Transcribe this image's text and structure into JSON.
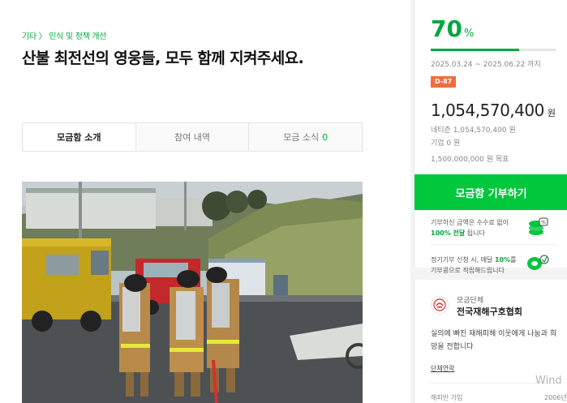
{
  "breadcrumb": "기타 〉 인식 및 정책 개선",
  "title": "산불 최전선의 영웅들, 모두 함께 지켜주세요.",
  "tabs": [
    {
      "label": "모금함 소개",
      "count": ""
    },
    {
      "label": "참여 내역",
      "count": ""
    },
    {
      "label": "모금 소식",
      "count": "0"
    }
  ],
  "funding": {
    "percent": "70",
    "percent_unit": "%",
    "progress": 0.7,
    "period": "2025.03.24 ~ 2025.06.22 까지",
    "dday": "D-87",
    "amount": "1,054,570,400",
    "amount_unit": "원",
    "netizen": "네티즌 1,054,570,400 원",
    "company": "기업 0 원",
    "goal": "1,500,000,000 원 목표"
  },
  "donate_button": "모금함 기부하기",
  "notices": {
    "fee_line1": "기부하신 금액은 수수료 없이",
    "fee_highlight": "100% 전달",
    "fee_line2": "됩니다",
    "regular_line1_a": "정기기부 신청 시, 매달 ",
    "regular_highlight": "10%",
    "regular_line1_b": "를",
    "regular_line2": "기부콩으로 적립해드립니다"
  },
  "organization": {
    "label": "모금단체",
    "name": "전국재해구호협회",
    "description": "실의에 빠진 재해피해 이웃에게 나눔과 희망을 전합니다",
    "link": "단체연락",
    "joined_label": "해피빈 가입",
    "joined_year": "2006년"
  },
  "watermark": "Wind",
  "colors": {
    "accent": "#00a83e",
    "button": "#00c73c",
    "dday": "#f26d3d"
  }
}
